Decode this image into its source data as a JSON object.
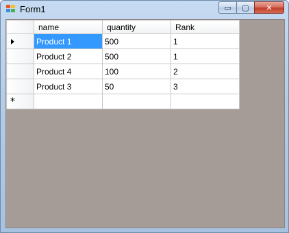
{
  "window": {
    "title": "Form1",
    "icon": "form-app-icon",
    "caption_buttons": {
      "minimize_icon": "minimize-icon",
      "maximize_icon": "maximize-icon",
      "close_icon": "close-icon",
      "minimize_glyph": "▭",
      "maximize_glyph": "▢",
      "close_glyph": "✕"
    }
  },
  "grid": {
    "columns": [
      "name",
      "quantity",
      "Rank"
    ],
    "rows": [
      {
        "name": "Product 1",
        "quantity": "500",
        "rank": "1",
        "current": true
      },
      {
        "name": "Product 2",
        "quantity": "500",
        "rank": "1",
        "current": false
      },
      {
        "name": "Product 4",
        "quantity": "100",
        "rank": "2",
        "current": false
      },
      {
        "name": "Product 3",
        "quantity": "50",
        "rank": "3",
        "current": false
      }
    ],
    "new_row_glyph": "*",
    "current_row_icon": "current-row-arrow-icon",
    "selection_color": "#3399ff",
    "background_color": "#a69c97"
  }
}
